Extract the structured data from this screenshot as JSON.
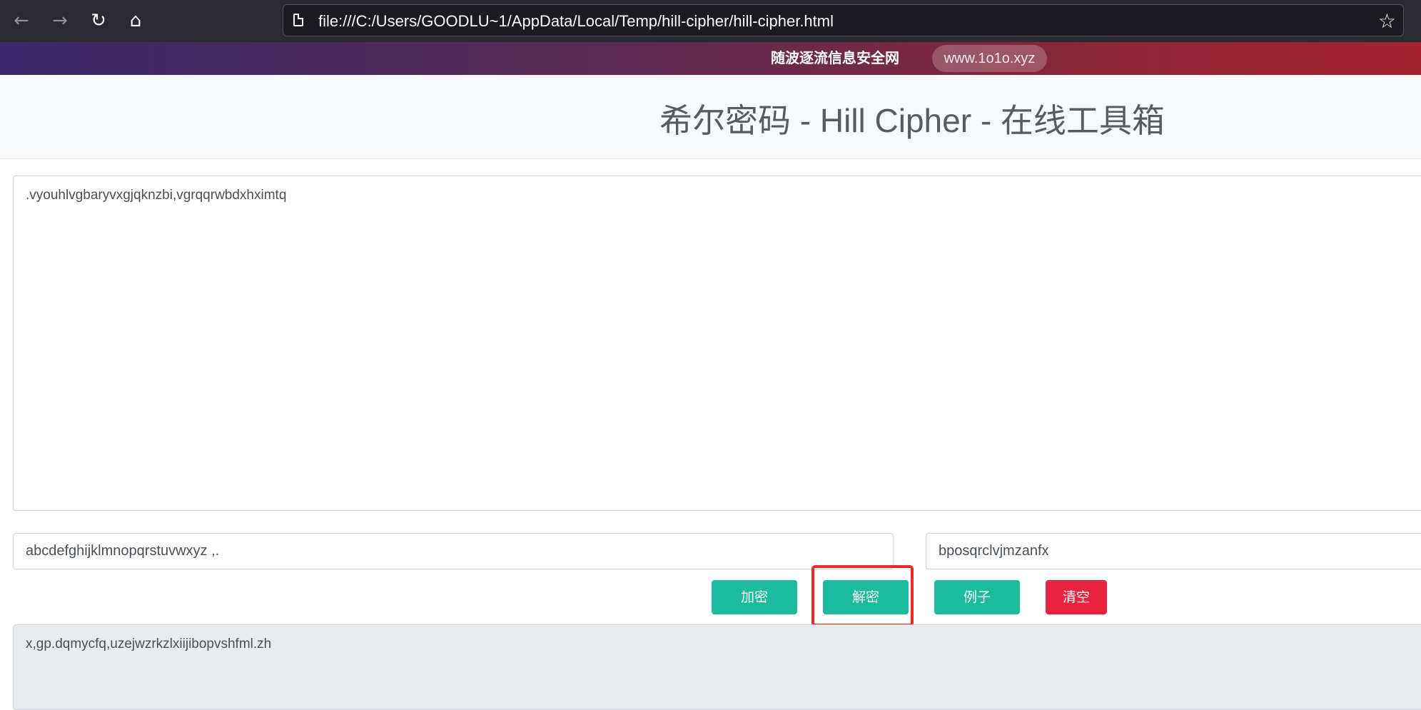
{
  "browser": {
    "back_icon": "←",
    "forward_icon": "→",
    "reload_icon": "↻",
    "home_icon": "⌂",
    "url": "file:///C:/Users/GOODLU~1/AppData/Local/Temp/hill-cipher/hill-cipher.html",
    "bookmark_icon": "☆"
  },
  "banner": {
    "site_name": "随波逐流信息安全网",
    "site_url": "www.1o1o.xyz"
  },
  "header": {
    "title": "希尔密码 - Hill Cipher - 在线工具箱"
  },
  "form": {
    "input_text": ".vyouhlvgbaryvxgjqknzbi,vgrqqrwbdxhximtq",
    "alphabet": "abcdefghijklmnopqrstuvwxyz ,.",
    "key": "bposqrclvjmzanfx",
    "output_text": "x,gp.dqmycfq,uzejwzrkzlxiijibopvshfml.zh"
  },
  "buttons": {
    "encrypt": "加密",
    "decrypt": "解密",
    "example": "例子",
    "clear": "清空"
  },
  "colors": {
    "primary_button": "#1abc9c",
    "danger_button": "#e8233f",
    "highlight": "#ee2a24"
  }
}
